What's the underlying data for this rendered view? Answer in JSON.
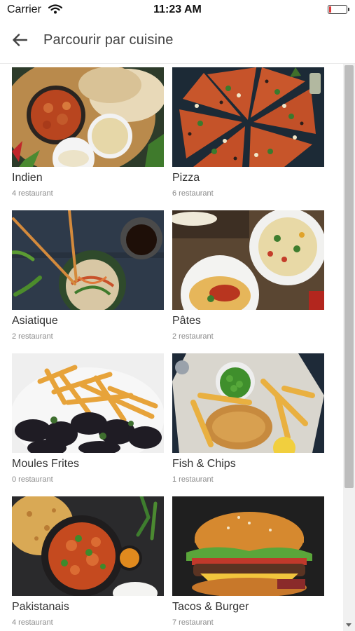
{
  "status_bar": {
    "carrier": "Carrier",
    "time": "11:23 AM"
  },
  "header": {
    "title": "Parcourir par cuisine"
  },
  "cuisines": [
    {
      "name": "Indien",
      "count": "4 restaurant",
      "image": "indian-curry-photo"
    },
    {
      "name": "Pizza",
      "count": "6 restaurant",
      "image": "pizza-photo"
    },
    {
      "name": "Asiatique",
      "count": "2 restaurant",
      "image": "asian-noodles-photo"
    },
    {
      "name": "Pâtes",
      "count": "2 restaurant",
      "image": "pasta-photo"
    },
    {
      "name": "Moules Frites",
      "count": "0 restaurant",
      "image": "mussels-fries-photo"
    },
    {
      "name": "Fish & Chips",
      "count": "1 restaurant",
      "image": "fish-chips-photo"
    },
    {
      "name": "Pakistanais",
      "count": "4 restaurant",
      "image": "pakistani-curry-photo"
    },
    {
      "name": "Tacos & Burger",
      "count": "7 restaurant",
      "image": "burger-photo"
    }
  ],
  "colors": {
    "battery_low": "#e03b3b",
    "title_text": "#444444",
    "count_text": "#8a8a8a"
  }
}
